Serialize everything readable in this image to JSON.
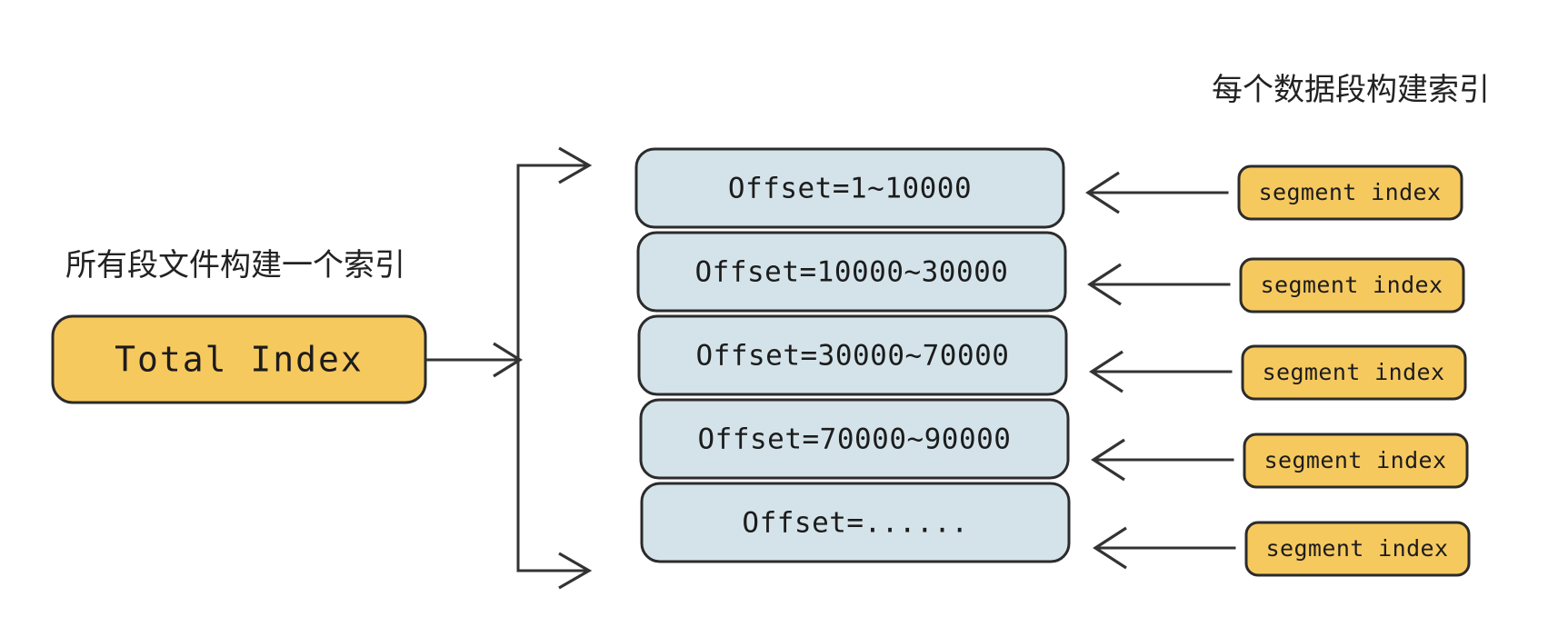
{
  "diagram": {
    "labels": {
      "left_title": "所有段文件构建一个索引",
      "right_title": "每个数据段构建索引"
    },
    "total_index": {
      "label": "Total Index",
      "fill": "#f6c95f",
      "stroke": "#2b2b2b"
    },
    "segments": [
      {
        "offset_label": "Offset=1~10000",
        "index_label": "segment index"
      },
      {
        "offset_label": "Offset=10000~30000",
        "index_label": "segment index"
      },
      {
        "offset_label": "Offset=30000~70000",
        "index_label": "segment index"
      },
      {
        "offset_label": "Offset=70000~90000",
        "index_label": "segment index"
      },
      {
        "offset_label": "Offset=......",
        "index_label": "segment index"
      }
    ],
    "colors": {
      "segment_box_fill": "#d4e3ea",
      "index_box_fill": "#f6c95f",
      "border": "#2b2b2b",
      "line": "#333333",
      "text": "#1c1c1c",
      "background": "#ffffff"
    }
  }
}
